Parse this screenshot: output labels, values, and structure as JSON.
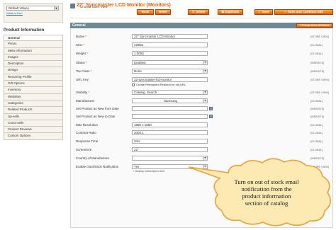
{
  "store": {
    "label": "Choose Store View:",
    "selected": "Default Values",
    "help": "What is this?"
  },
  "sidebar": {
    "title": "Product Information",
    "items": [
      {
        "label": "General",
        "active": true
      },
      {
        "label": "Prices"
      },
      {
        "label": "Meta Information"
      },
      {
        "label": "Images"
      },
      {
        "label": "Description"
      },
      {
        "label": "Design"
      },
      {
        "label": "Recurring Profile"
      },
      {
        "label": "Gift Options"
      },
      {
        "label": "Inventory"
      },
      {
        "label": "Websites"
      },
      {
        "label": "Categories"
      },
      {
        "label": "Related Products"
      },
      {
        "label": "Up-sells"
      },
      {
        "label": "Cross-sells"
      },
      {
        "label": "Product Reviews"
      },
      {
        "label": "Custom Options"
      }
    ]
  },
  "header": {
    "title": "22\" Syncmaster LCD Monitor (Monitors)",
    "buttons": {
      "back": "Back",
      "reset": "Reset",
      "delete": "Delete",
      "duplicate": "Duplicate",
      "save": "Save",
      "save_continue": "Save and Continue Edit"
    }
  },
  "form": {
    "section_title": "General",
    "create_attr": "Create New Attribute",
    "fields": {
      "name": {
        "label": "Name",
        "value": "22\" Syncmaster LCD Monitor",
        "scope": "[STORE VIEW]"
      },
      "sku": {
        "label": "SKU",
        "value": "226bw",
        "scope": "[GLOBAL]"
      },
      "weight": {
        "label": "Weight",
        "value": "1.0000",
        "scope": "[GLOBAL]"
      },
      "status": {
        "label": "Status",
        "value": "Enabled",
        "scope": "[WEBSITE]"
      },
      "tax_class": {
        "label": "Tax Class",
        "value": "None",
        "scope": "[WEBSITE]"
      },
      "url_key": {
        "label": "URL Key",
        "value": "22-syncmaster-lcd-monitor",
        "scope": "[STORE VIEW]",
        "checkbox": "Create Permanent Redirect for old URL"
      },
      "visibility": {
        "label": "Visibility",
        "value": "Catalog, Search",
        "scope": "[STORE VIEW]"
      },
      "manufacturer": {
        "label": "Manufacturer",
        "value": "Samsung",
        "scope": "[GLOBAL]"
      },
      "new_from": {
        "label": "Set Product as New from Date",
        "value": "",
        "scope": "[WEBSITE]"
      },
      "new_to": {
        "label": "Set Product as New to Date",
        "value": "",
        "scope": "[WEBSITE]"
      },
      "max_resolution": {
        "label": "Max Resolution",
        "value": "1680 x 1050",
        "scope": "[GLOBAL]"
      },
      "contrast_ratio": {
        "label": "Contrast Ratio",
        "value": "3000:1",
        "scope": "[GLOBAL]"
      },
      "response_time": {
        "label": "Response Time",
        "value": "2ms",
        "scope": "[GLOBAL]"
      },
      "screensize": {
        "label": "Screensize",
        "value": "22\"",
        "scope": "[GLOBAL]"
      },
      "country": {
        "label": "Country of Manufacture",
        "value": "",
        "scope": "[WEBSITE]"
      },
      "outofstock": {
        "label": "Enable Outofstock Notification",
        "value": "Yes",
        "scope": "[STORE VIEW]",
        "note": "Display subscription field"
      }
    }
  },
  "callout": {
    "lines": [
      "Turn on out of stock email",
      "notification from the",
      "product information",
      "section of catalog"
    ]
  },
  "colors": {
    "accent": "#eb5e00",
    "section_header": "#6f8992",
    "callout_fill": "#fde9b2",
    "callout_stroke": "#e8a23c"
  }
}
